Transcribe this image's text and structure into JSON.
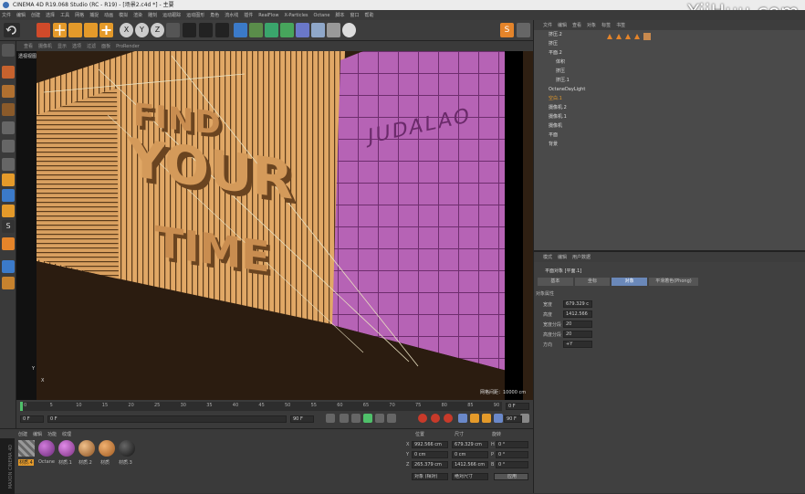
{
  "window": {
    "title": "CINEMA 4D R19.068 Studio (RC - R19) - [场景2.c4d *] - 主要"
  },
  "watermark": "YiiHuu.com",
  "menu": [
    "文件",
    "编辑",
    "创建",
    "选择",
    "工具",
    "网格",
    "捕捉",
    "动画",
    "模拟",
    "渲染",
    "雕刻",
    "运动跟踪",
    "运动图形",
    "角色",
    "流水线",
    "插件",
    "RealFlow",
    "X-Particles",
    "Octane",
    "脚本",
    "窗口",
    "帮助"
  ],
  "viewport": {
    "menu": [
      "查看",
      "摄像机",
      "显示",
      "选项",
      "过滤",
      "面板",
      "ProRender"
    ],
    "label": "透视视图",
    "scene_text": {
      "line1": "FIND",
      "line2": "YOUR",
      "line3": "TIME",
      "wall": "JUDALAO"
    },
    "grid_info": "网格间距：10000 cm",
    "axis_y": "Y",
    "axis_x": "X",
    "accent_colors": {
      "wood": "#e1a866",
      "wall": "#b663b5",
      "floor": "#2e1f12"
    }
  },
  "timeline": {
    "ticks": [
      "0",
      "5",
      "10",
      "15",
      "20",
      "25",
      "30",
      "35",
      "40",
      "45",
      "50",
      "55",
      "60",
      "65",
      "70",
      "75",
      "80",
      "85",
      "90"
    ],
    "frame_end": "0 F",
    "current_frame": "0 F",
    "start_field": "0 F",
    "end_field": "90 F",
    "end_field2": "90 F"
  },
  "materials": {
    "menu": [
      "创建",
      "编辑",
      "功能",
      "纹理"
    ],
    "items": [
      {
        "name": "材质.4",
        "color": "#8a8a8a"
      },
      {
        "name": "Octane",
        "color": "#9b4aa8"
      },
      {
        "name": "材质.1",
        "color": "#b057b8"
      },
      {
        "name": "材质.2",
        "color": "#c98a4e"
      },
      {
        "name": "材质",
        "color": "#c77c3a"
      },
      {
        "name": "材质.3",
        "color": "#2a2a2a"
      }
    ],
    "maxon": "MAXON CINEMA 4D"
  },
  "coordinates": {
    "headers": [
      "位置",
      "尺寸",
      "旋转"
    ],
    "rows": [
      {
        "axis": "X",
        "pos": "992.566 cm",
        "size": "679.329 cm",
        "rot_label": "H",
        "rot": "0 °"
      },
      {
        "axis": "Y",
        "pos": "0 cm",
        "size": "0 cm",
        "rot_label": "P",
        "rot": "0 °"
      },
      {
        "axis": "Z",
        "pos": "265.379 cm",
        "size": "1412.566 cm",
        "rot_label": "B",
        "rot": "0 °"
      }
    ],
    "mode_select": "对象 (相对)",
    "size_select": "绝对尺寸",
    "apply_button": "应用"
  },
  "object_manager": {
    "menu": [
      "文件",
      "编辑",
      "查看",
      "对象",
      "标签",
      "书签"
    ],
    "objects": [
      {
        "name": "挤压.2",
        "level": 0
      },
      {
        "name": "挤压",
        "level": 0
      },
      {
        "name": "平面.2",
        "level": 0
      },
      {
        "name": "体积",
        "level": 1
      },
      {
        "name": "挤压",
        "level": 1
      },
      {
        "name": "挤压.1",
        "level": 1
      },
      {
        "name": "OctaneDayLight",
        "level": 0
      },
      {
        "name": "空白.1",
        "level": 0
      },
      {
        "name": "摄像机.2",
        "level": 0
      },
      {
        "name": "摄像机.1",
        "level": 0
      },
      {
        "name": "摄像机",
        "level": 0
      },
      {
        "name": "平面",
        "level": 0
      },
      {
        "name": "背景",
        "level": 0
      }
    ]
  },
  "attributes": {
    "menu": [
      "模式",
      "编辑",
      "用户数据"
    ],
    "object_title": "平面对象 [平面.1]",
    "tabs": [
      "基本",
      "坐标",
      "对象",
      "平滑着色(Phong)"
    ],
    "active_tab": "对象",
    "section": "对象属性",
    "fields": [
      {
        "label": "宽度",
        "value": "679.329 c"
      },
      {
        "label": "高度",
        "value": "1412.566"
      },
      {
        "label": "宽度分段",
        "value": "20"
      },
      {
        "label": "高度分段",
        "value": "20"
      },
      {
        "label": "方向",
        "value": "+Y"
      }
    ]
  }
}
